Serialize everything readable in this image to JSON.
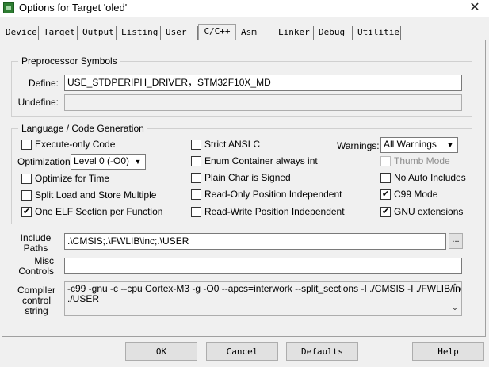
{
  "window": {
    "title": "Options for Target 'oled'",
    "close_glyph": "✕"
  },
  "tabs": [
    "Device",
    "Target",
    "Output",
    "Listing",
    "User",
    "C/C++",
    "Asm",
    "Linker",
    "Debug",
    "Utilities"
  ],
  "active_tab": "C/C++",
  "preprocessor": {
    "legend": "Preprocessor Symbols",
    "define_label": "Define:",
    "define_value": "USE_STDPERIPH_DRIVER，STM32F10X_MD",
    "undefine_label": "Undefine:",
    "undefine_value": ""
  },
  "language": {
    "legend": "Language / Code Generation",
    "checkboxes": [
      {
        "label": "Execute-only Code",
        "checked": false,
        "enabled": true
      },
      {
        "label": "Optimize for Time",
        "checked": false,
        "enabled": true
      },
      {
        "label": "Split Load and Store Multiple",
        "checked": false,
        "enabled": true
      },
      {
        "label": "One ELF Section per Function",
        "checked": true,
        "enabled": true
      },
      {
        "label": "Strict ANSI C",
        "checked": false,
        "enabled": true
      },
      {
        "label": "Enum Container always int",
        "checked": false,
        "enabled": true
      },
      {
        "label": "Plain Char is Signed",
        "checked": false,
        "enabled": true
      },
      {
        "label": "Read-Only Position Independent",
        "checked": false,
        "enabled": true
      },
      {
        "label": "Read-Write Position Independent",
        "checked": false,
        "enabled": true
      },
      {
        "label": "Thumb Mode",
        "checked": false,
        "enabled": false
      },
      {
        "label": "No Auto Includes",
        "checked": false,
        "enabled": true
      },
      {
        "label": "C99 Mode",
        "checked": true,
        "enabled": true
      },
      {
        "label": "GNU extensions",
        "checked": true,
        "enabled": true
      }
    ],
    "optimization_label": "Optimization:",
    "optimization_value": "Level 0 (-O0)",
    "warnings_label": "Warnings:",
    "warnings_value": "All Warnings"
  },
  "include": {
    "label_line1": "Include",
    "label_line2": "Paths",
    "value": ".\\CMSIS;.\\FWLIB\\inc;.\\USER",
    "browse": "..."
  },
  "misc": {
    "label_line1": "Misc",
    "label_line2": "Controls",
    "value": ""
  },
  "compiler": {
    "label_line1": "Compiler",
    "label_line2": "control",
    "label_line3": "string",
    "line1": "-c99 -gnu -c --cpu Cortex-M3 -g -O0 --apcs=interwork --split_sections -I ./CMSIS -I ./FWLIB/inc -I",
    "line2": "./USER"
  },
  "buttons": {
    "ok": "OK",
    "cancel": "Cancel",
    "defaults": "Defaults",
    "help": "Help"
  },
  "glyphs": {
    "check": "✔",
    "dropdown": "▼",
    "scroll_up": "⌃",
    "scroll_down": "⌄"
  }
}
